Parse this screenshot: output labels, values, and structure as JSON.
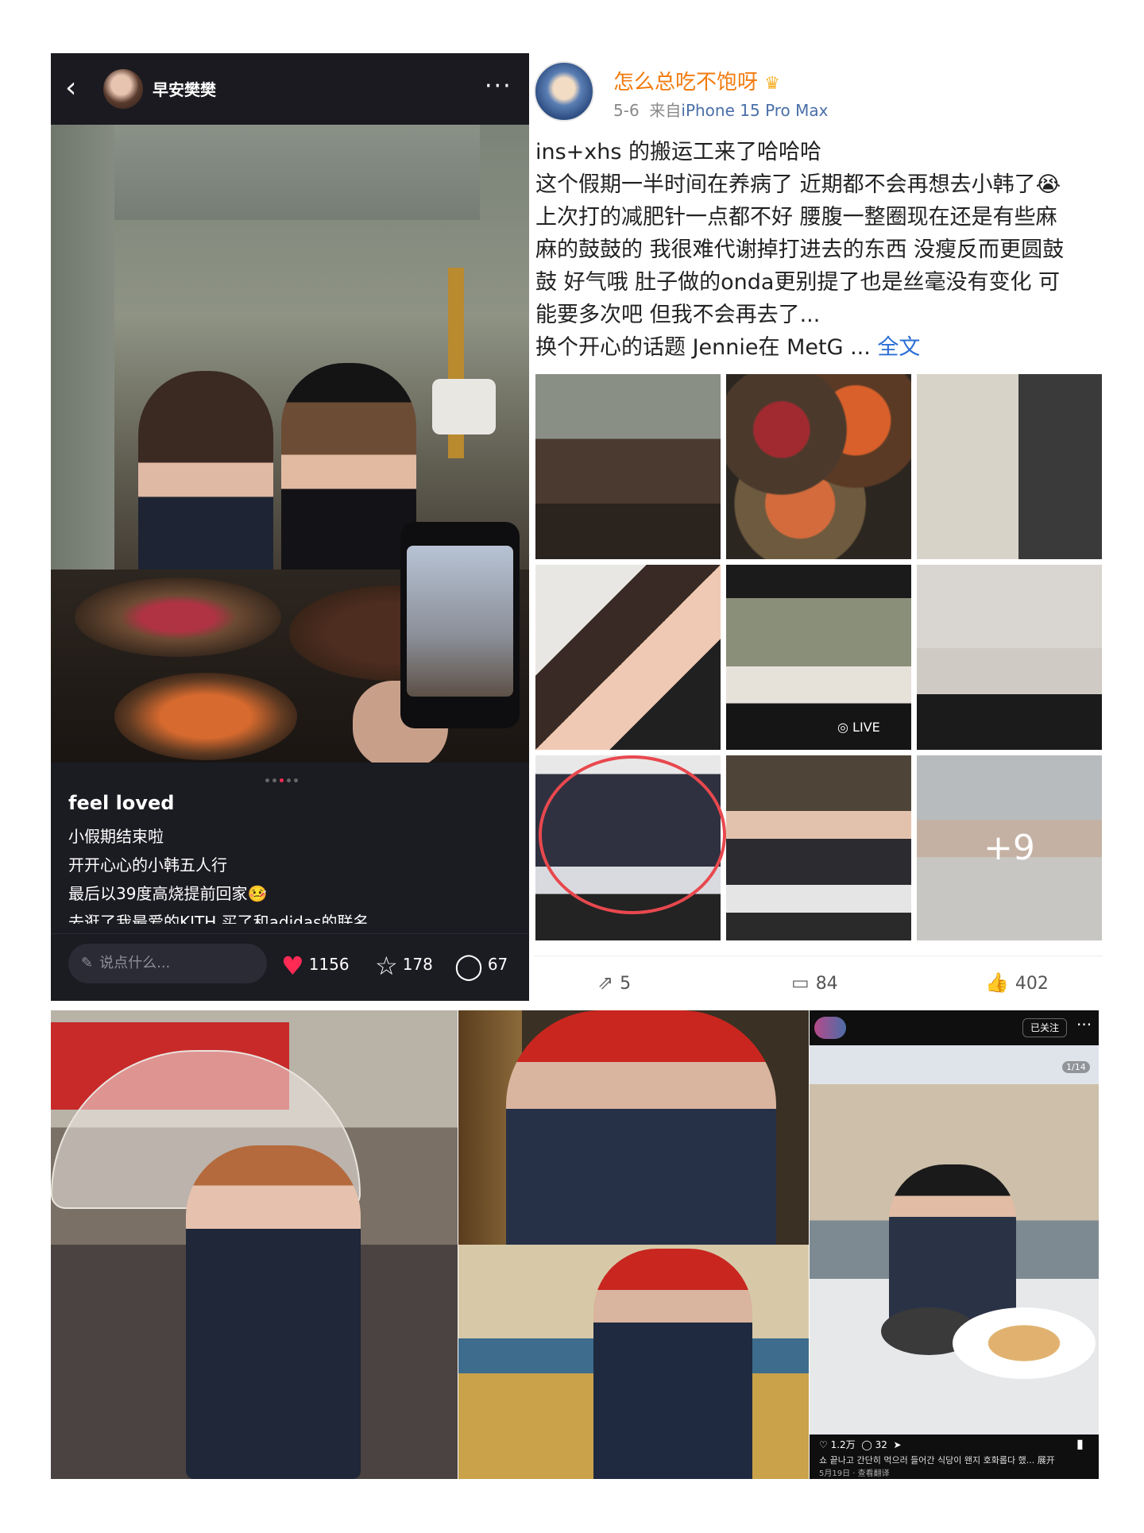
{
  "xhs": {
    "username": "早安樊樊",
    "back_icon": "‹",
    "more_icon": "···",
    "post_title": "feel loved",
    "description": [
      "小假期结束啦",
      "开开心心的小韩五人行",
      "最后以39度高烧提前回家🤒",
      "去逛了我最爱的KITH 买了和adidas的联名"
    ],
    "comment_placeholder": "说点什么...",
    "likes": "1156",
    "favorites": "178",
    "comments": "67",
    "accent_color": "#ff2b55"
  },
  "weibo": {
    "nickname": "怎么总吃不饱呀",
    "date": "5-6",
    "source_prefix": "来自",
    "device": "iPhone 15 Pro Max",
    "body_lines": [
      "ins+xhs 的搬运工来了哈哈哈",
      "这个假期一半时间在养病了 近期都不会再想去小韩了😭",
      "上次打的减肥针一点都不好 腰腹一整圈现在还是有些麻",
      "麻的鼓鼓的 我很难代谢掉打进去的东西 没瘦反而更圆鼓",
      "鼓 好气哦 肚子做的onda更别提了也是丝毫没有变化 可",
      "能要多次吧 但我不会再去了..."
    ],
    "body_last": "换个开心的话题 Jennie在 MetG ...",
    "more_label": "全文",
    "live_label": "LIVE",
    "plus_count": "+9",
    "reposts": "5",
    "comments": "84",
    "likes": "402",
    "nickname_color": "#f27b0e",
    "link_color": "#2a6fd6"
  },
  "instagram": {
    "follow_label": "已关注",
    "counter": "1/14",
    "likes": "1.2万",
    "comments": "32",
    "caption": "쇼 끝나고 간단히 먹으러 들어간 식당이 왠지 호화롭다 했... 展开",
    "date": "5月19日",
    "translate": "查看翻译"
  }
}
